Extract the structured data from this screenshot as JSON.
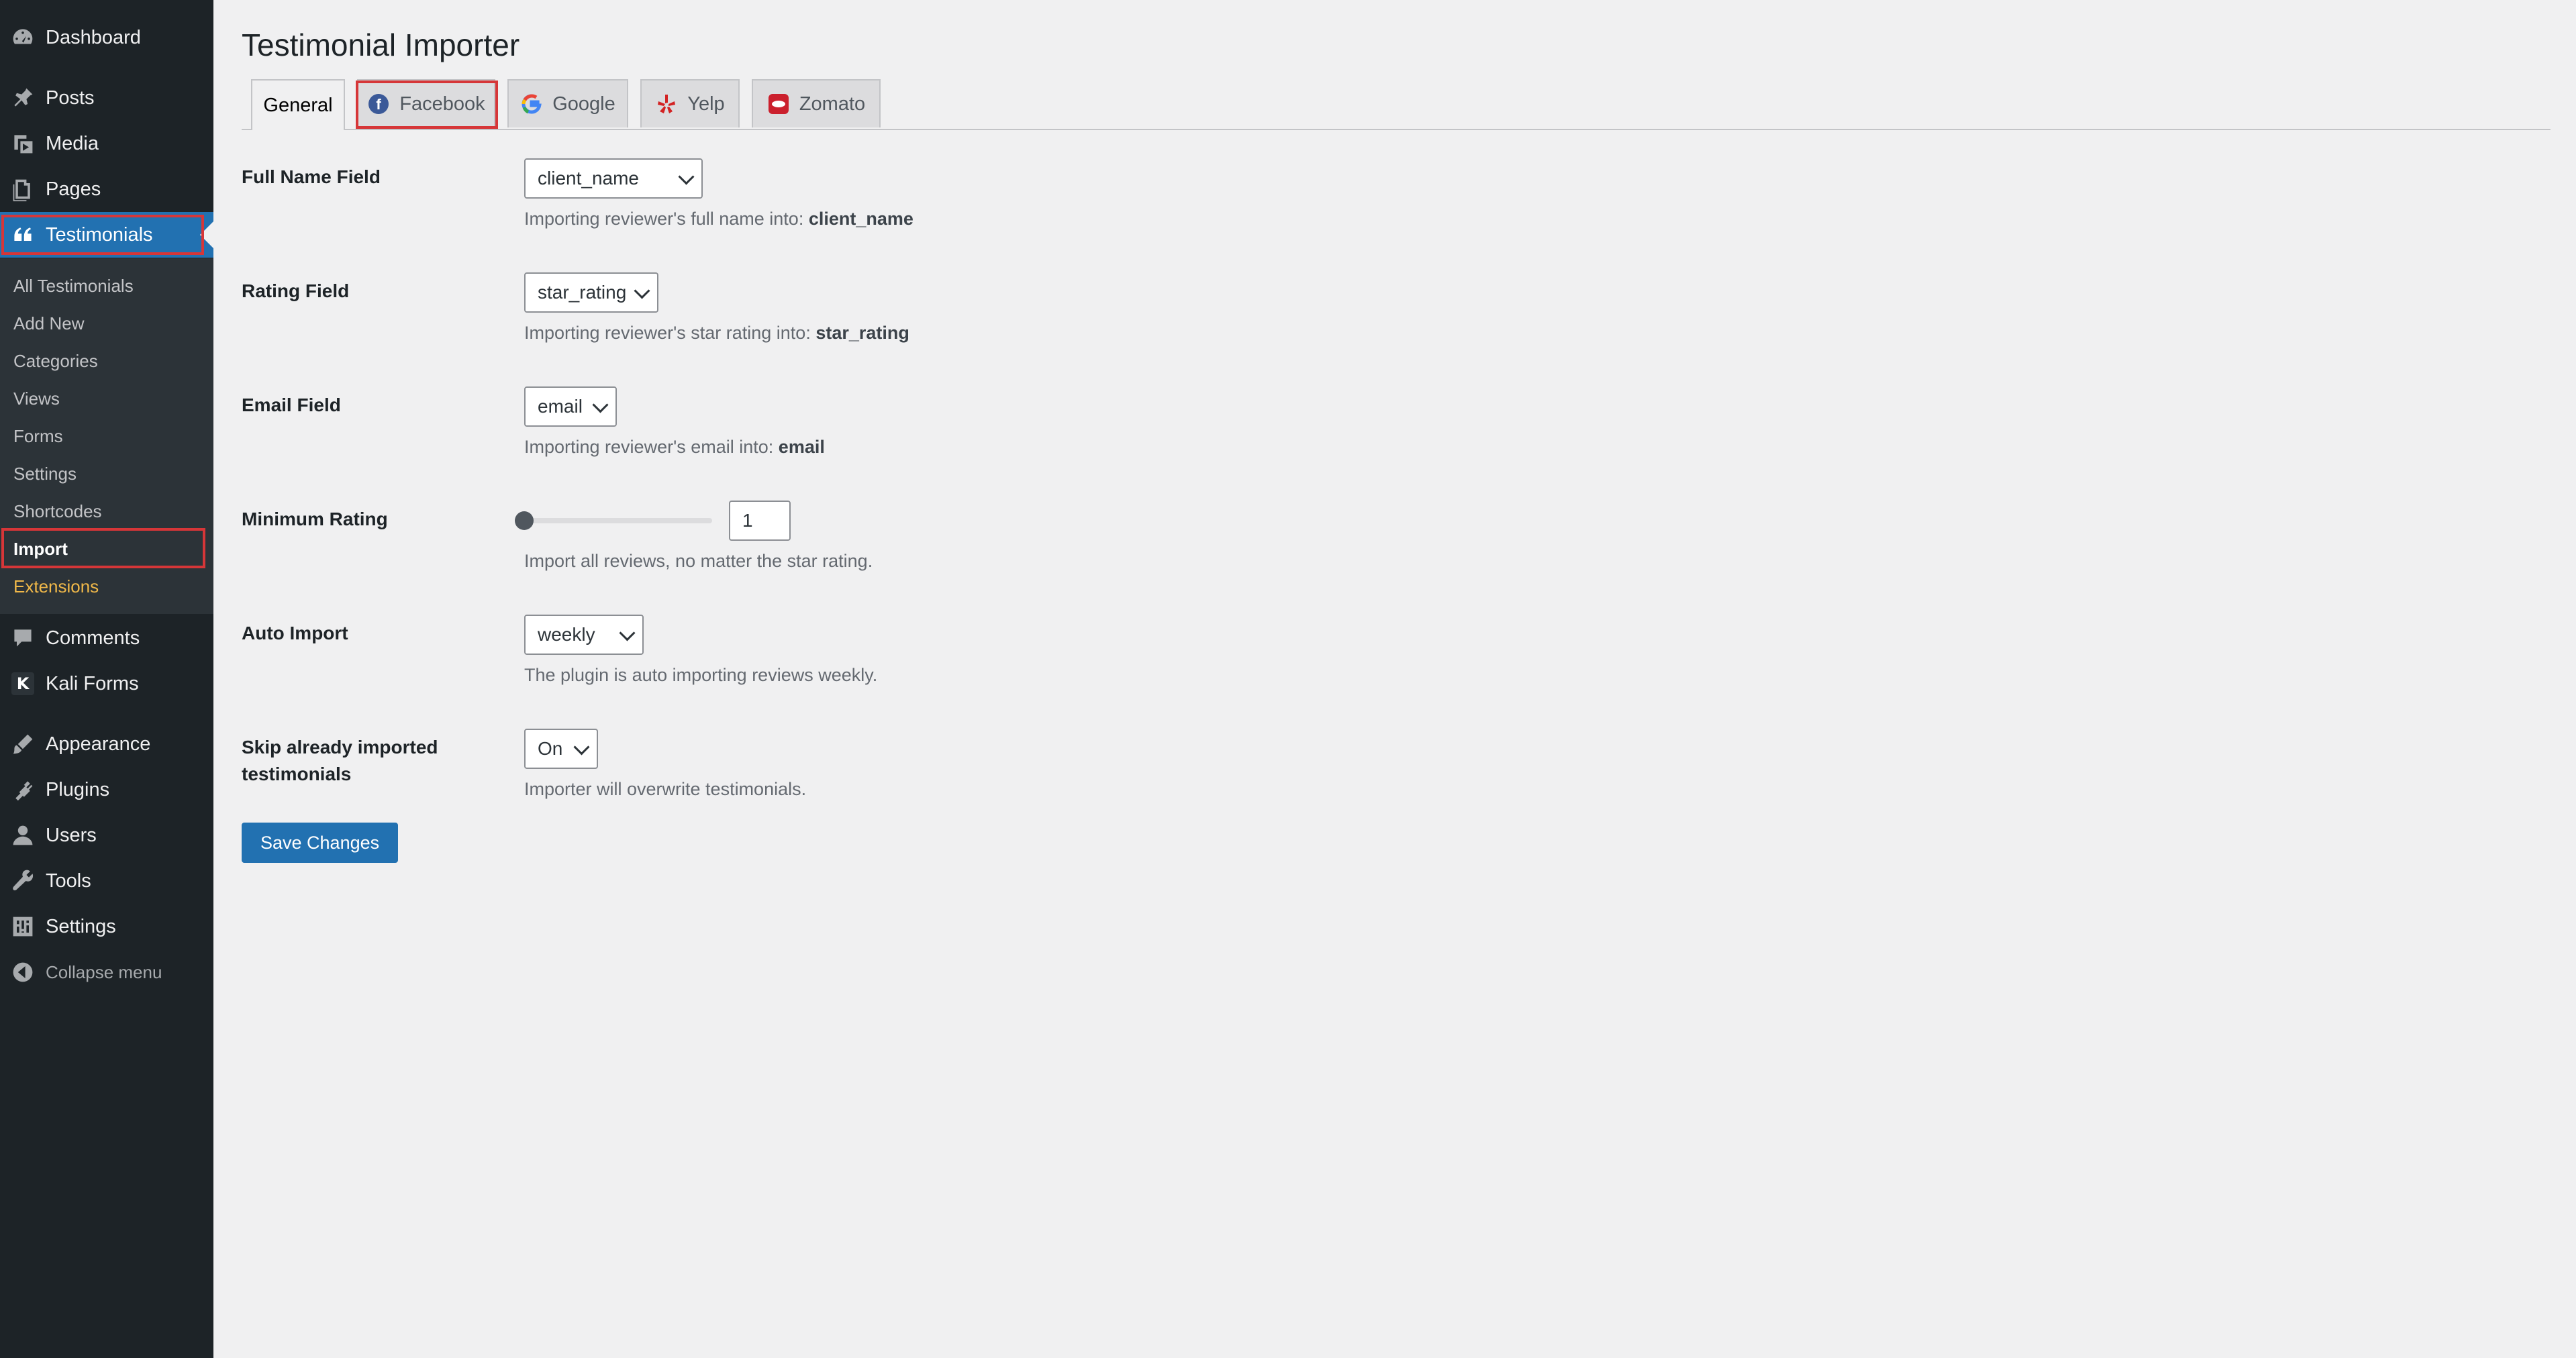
{
  "sidebar": {
    "items": [
      {
        "label": "Dashboard",
        "icon": "dashboard-icon"
      },
      {
        "label": "Posts",
        "icon": "pushpin-icon"
      },
      {
        "label": "Media",
        "icon": "media-icon"
      },
      {
        "label": "Pages",
        "icon": "pages-icon"
      },
      {
        "label": "Testimonials",
        "icon": "quote-icon"
      }
    ],
    "submenu": [
      "All Testimonials",
      "Add New",
      "Categories",
      "Views",
      "Forms",
      "Settings",
      "Shortcodes",
      "Import",
      "Extensions"
    ],
    "items2": [
      {
        "label": "Comments",
        "icon": "comments-icon"
      },
      {
        "label": "Kali Forms",
        "icon": "kali-forms-icon"
      },
      {
        "label": "Appearance",
        "icon": "brush-icon"
      },
      {
        "label": "Plugins",
        "icon": "plugin-icon"
      },
      {
        "label": "Users",
        "icon": "user-icon"
      },
      {
        "label": "Tools",
        "icon": "wrench-icon"
      },
      {
        "label": "Settings",
        "icon": "settings-icon"
      }
    ],
    "kali_letter": "K",
    "collapse_label": "Collapse menu"
  },
  "page": {
    "title": "Testimonial Importer"
  },
  "tabs": [
    {
      "label": "General"
    },
    {
      "label": "Facebook"
    },
    {
      "label": "Google"
    },
    {
      "label": "Yelp"
    },
    {
      "label": "Zomato"
    }
  ],
  "form": {
    "full_name": {
      "label": "Full Name Field",
      "value": "client_name",
      "desc_prefix": "Importing reviewer's full name into: ",
      "desc_value": "client_name"
    },
    "rating": {
      "label": "Rating Field",
      "value": "star_rating",
      "desc_prefix": "Importing reviewer's star rating into: ",
      "desc_value": "star_rating"
    },
    "email": {
      "label": "Email Field",
      "value": "email",
      "desc_prefix": "Importing reviewer's email into: ",
      "desc_value": "email"
    },
    "min_rating": {
      "label": "Minimum Rating",
      "value": "1",
      "desc": "Import all reviews, no matter the star rating."
    },
    "auto_import": {
      "label": "Auto Import",
      "value": "weekly",
      "desc": "The plugin is auto importing reviews weekly."
    },
    "skip": {
      "label": "Skip already imported testimonials",
      "value": "On",
      "desc": "Importer will overwrite testimonials."
    }
  },
  "save_label": "Save Changes",
  "colors": {
    "sidebar_bg": "#1d2327",
    "submenu_bg": "#2c3338",
    "accent": "#2271b1",
    "highlight": "#d63638",
    "extensions": "#f0b849"
  }
}
